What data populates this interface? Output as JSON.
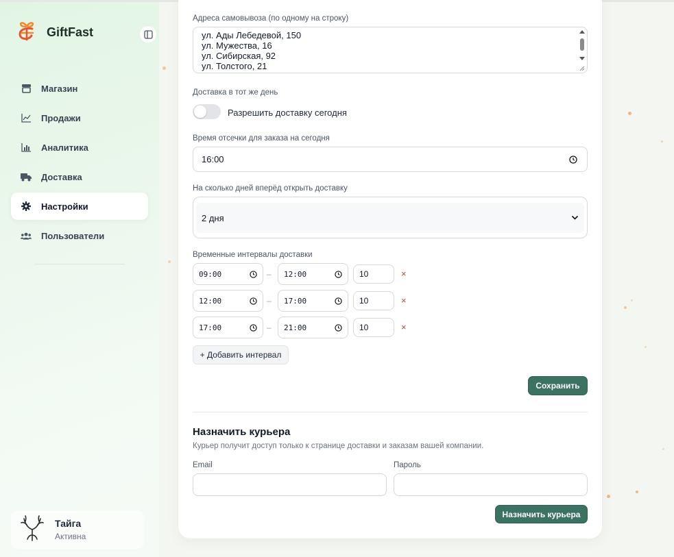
{
  "app": {
    "name": "GiftFast"
  },
  "sidebar": {
    "items": [
      {
        "label": "Магазин",
        "icon": "store-icon"
      },
      {
        "label": "Продажи",
        "icon": "line-chart-icon"
      },
      {
        "label": "Аналитика",
        "icon": "bar-chart-icon"
      },
      {
        "label": "Доставка",
        "icon": "truck-icon"
      },
      {
        "label": "Настройки",
        "icon": "gear-icon",
        "active": true
      },
      {
        "label": "Пользователи",
        "icon": "users-icon"
      }
    ]
  },
  "account": {
    "name": "Тайга",
    "status": "Активна",
    "logo": "deer-antlers-logo"
  },
  "pickup": {
    "label": "Адреса самовывоза (по одному на строку)",
    "lines": [
      "ул. Ады Лебедевой, 150",
      "ул. Мужества, 16",
      "ул. Сибирская, 92",
      "ул. Толстого, 21"
    ]
  },
  "same_day": {
    "label": "Доставка в тот же день",
    "toggle_label": "Разрешить доставку сегодня",
    "enabled": false
  },
  "cutoff": {
    "label": "Время отсечки для заказа на сегодня",
    "value": "16:00"
  },
  "days_ahead": {
    "label": "На сколько дней вперёд открыть доставку",
    "value": "2 дня"
  },
  "intervals": {
    "label": "Временные интервалы доставки",
    "dash": "–",
    "remove": "×",
    "rows": [
      {
        "from": "09:00",
        "to": "12:00",
        "qty": "10"
      },
      {
        "from": "12:00",
        "to": "17:00",
        "qty": "10"
      },
      {
        "from": "17:00",
        "to": "21:00",
        "qty": "10"
      }
    ],
    "add_label": "+ Добавить интервал"
  },
  "save_label": "Сохранить",
  "courier": {
    "title": "Назначить курьера",
    "description": "Курьер получит доступ только к странице доставки и заказам вашей компании.",
    "email_label": "Email",
    "email_value": "",
    "password_label": "Пароль",
    "password_value": "",
    "submit_label": "Назначить курьера"
  },
  "colors": {
    "accent": "#3c7262",
    "danger": "#c2453b",
    "sidebar_bg": "#e2f5e4"
  }
}
